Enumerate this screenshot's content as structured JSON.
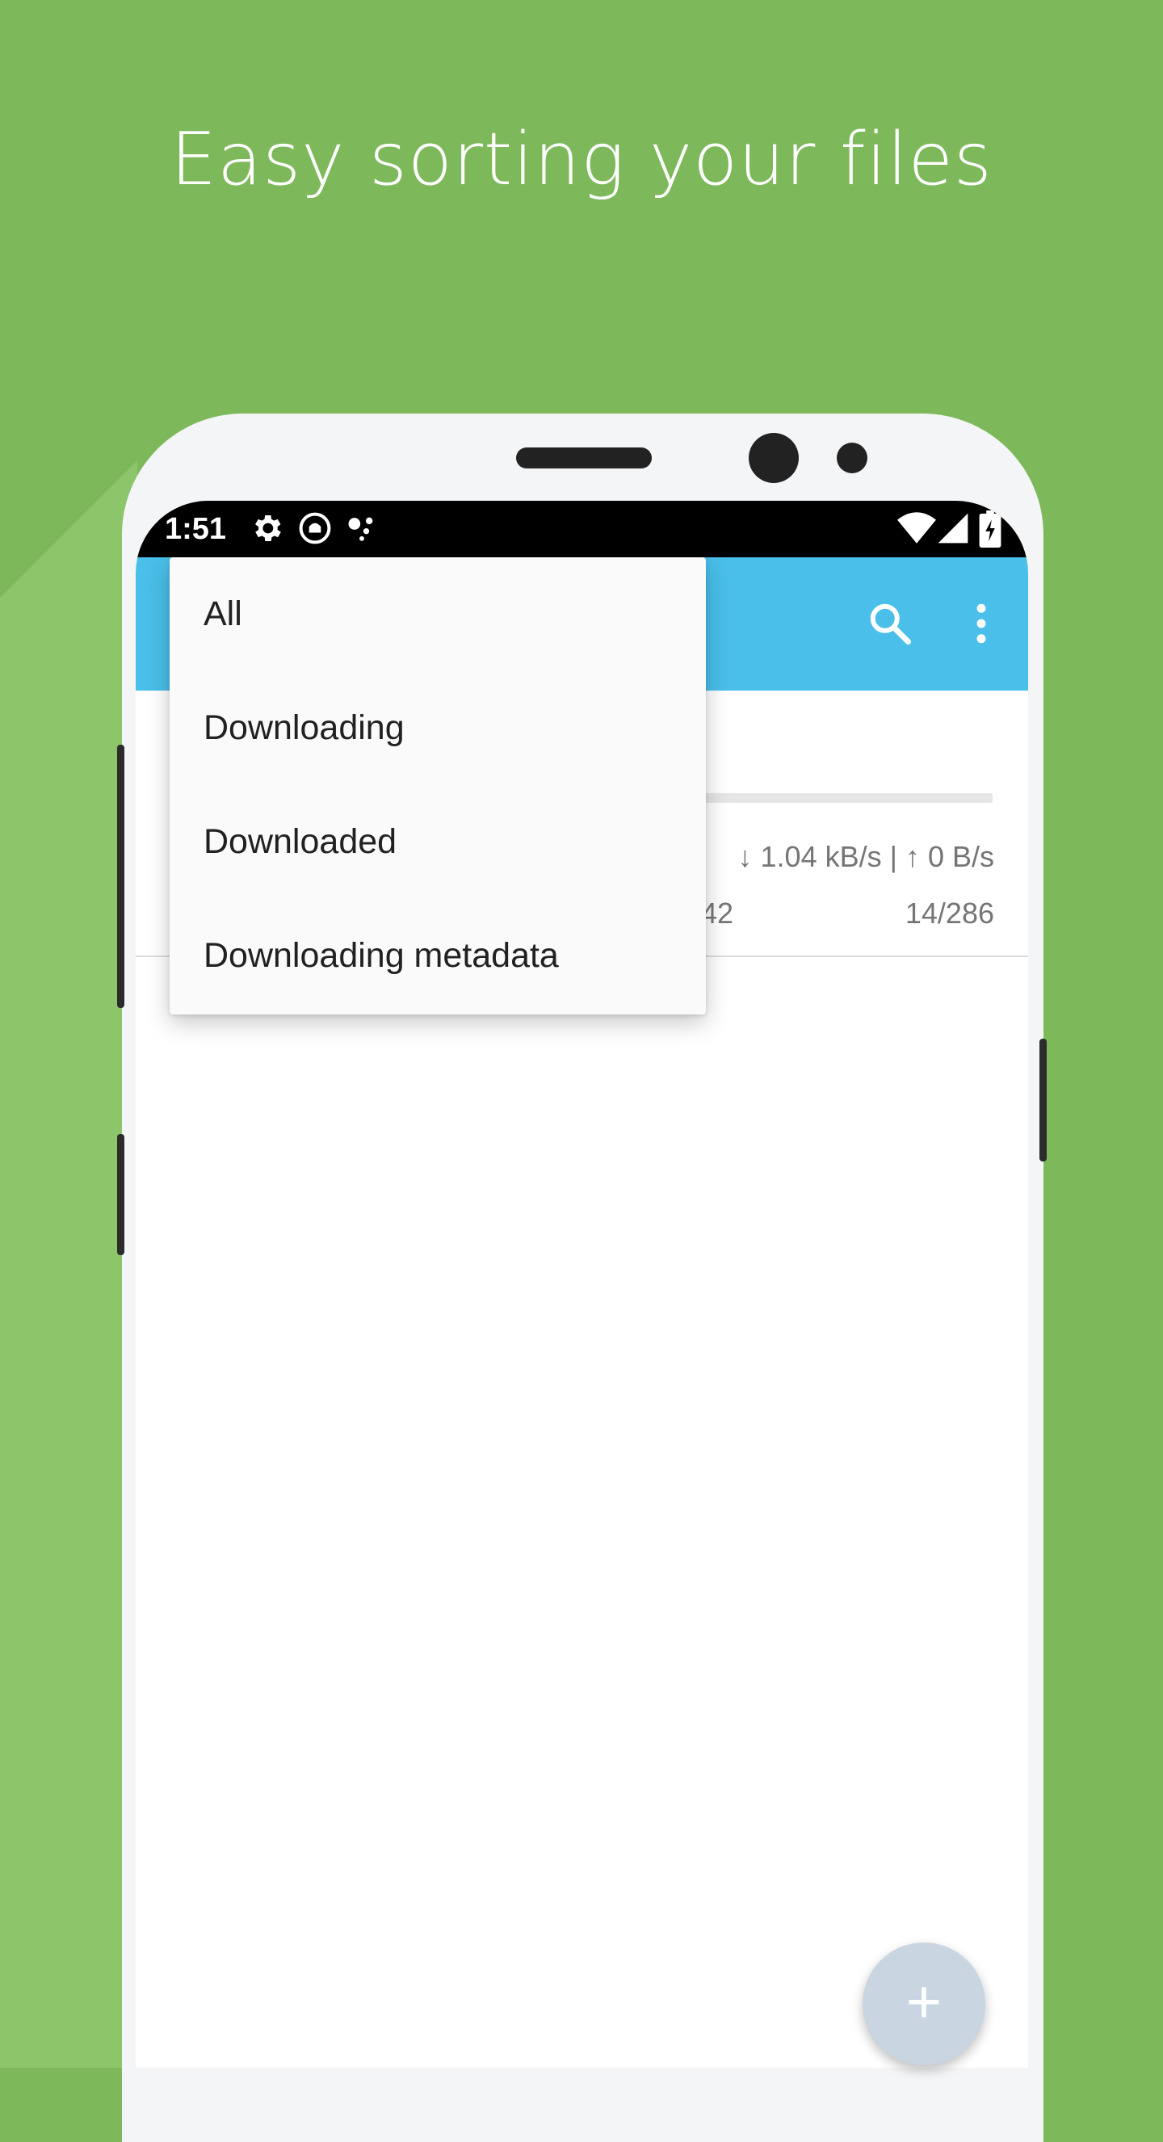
{
  "headline": "Easy sorting your files",
  "status_bar": {
    "time": "1:51",
    "icons": [
      "settings-icon",
      "android-debug-icon",
      "dots-icon",
      "wifi-icon",
      "signal-icon",
      "battery-charging-icon"
    ]
  },
  "app_bar": {
    "icons": [
      "search-icon",
      "more-vert-icon"
    ]
  },
  "torrent_item": {
    "speed": "↓ 1.04 kB/s | ↑ 0 B/s",
    "peers_partial": "42",
    "pieces": "14/286",
    "progress": 0.05
  },
  "sort_menu": {
    "items": [
      "All",
      "Downloading",
      "Downloaded",
      "Downloading metadata"
    ]
  },
  "fab": {
    "label": "+"
  },
  "colors": {
    "background": "#7db95a",
    "app_bar": "#49bfe9",
    "fab": "#c9d5e0"
  }
}
